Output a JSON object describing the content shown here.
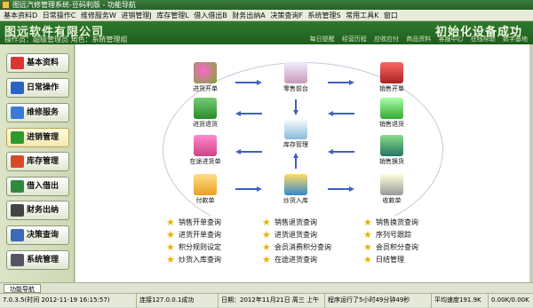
{
  "window": {
    "title": "图远汽修管理系统-豆码利版 - 功能导航"
  },
  "menu": [
    "基本资料D",
    "日常操作C",
    "维修服务W",
    "进销管理J",
    "库存管理L",
    "借入借出B",
    "财务出纳A",
    "决策查询F",
    "系统管理S",
    "常用工具K",
    "窗口"
  ],
  "header": {
    "company": "图远软件有限公司",
    "operator": "操作员：超级管理员  角色：系统管理组",
    "success": "初始化设备成功",
    "links": [
      "每日提醒",
      "经营历程",
      "应收应付",
      "商品资料",
      "客服中心",
      "在线帮助",
      "数字基地"
    ]
  },
  "sidebar": [
    {
      "label": "基本资料",
      "color": "#d33"
    },
    {
      "label": "日常操作",
      "color": "#2a62c8"
    },
    {
      "label": "维修服务",
      "color": "#3a7ad8"
    },
    {
      "label": "进销管理",
      "color": "#2e9a2e"
    },
    {
      "label": "库存管理",
      "color": "#d84a2a"
    },
    {
      "label": "借入借出",
      "color": "#2e8a3e"
    },
    {
      "label": "财务出纳",
      "color": "#444"
    },
    {
      "label": "决策查询",
      "color": "#3a6ab8"
    },
    {
      "label": "系统管理",
      "color": "#556"
    }
  ],
  "flow": {
    "purchase_order": "进货开单",
    "purchase_return": "进货退货",
    "in_transit": "在途进货单",
    "payment": "付款单",
    "retail": "零售前台",
    "inventory": "库存管理",
    "stock_in": "炒货入库",
    "sales_order": "销售开单",
    "sales_return": "销售退货",
    "sales_exchange": "销售换货",
    "receipt": "收款单"
  },
  "quick_links": [
    [
      "销售开单查询",
      "销售退货查询",
      "销售换货查询"
    ],
    [
      "进货开单查询",
      "进货退货查询",
      "序列号跟踪"
    ],
    [
      "积分规则设定",
      "会员消费积分查询",
      "会员积分查询"
    ],
    [
      "炒货入库查询",
      "在途进货查询",
      "日结管理"
    ]
  ],
  "tab": {
    "label": "功能导航"
  },
  "status": {
    "version": "7.0.3.5(时间 2012-11-19 16:15:57)",
    "connection": "连接127.0.0.1成功",
    "date": "日期：2012年11月21日 周三 上午",
    "runtime": "程序运行了5小时49分钟49秒",
    "speed": "平均速度191.9K",
    "rate": "0.00K/0.00K"
  },
  "colors": {
    "header_green": "#2e7a2e",
    "star": "#e8b400"
  }
}
